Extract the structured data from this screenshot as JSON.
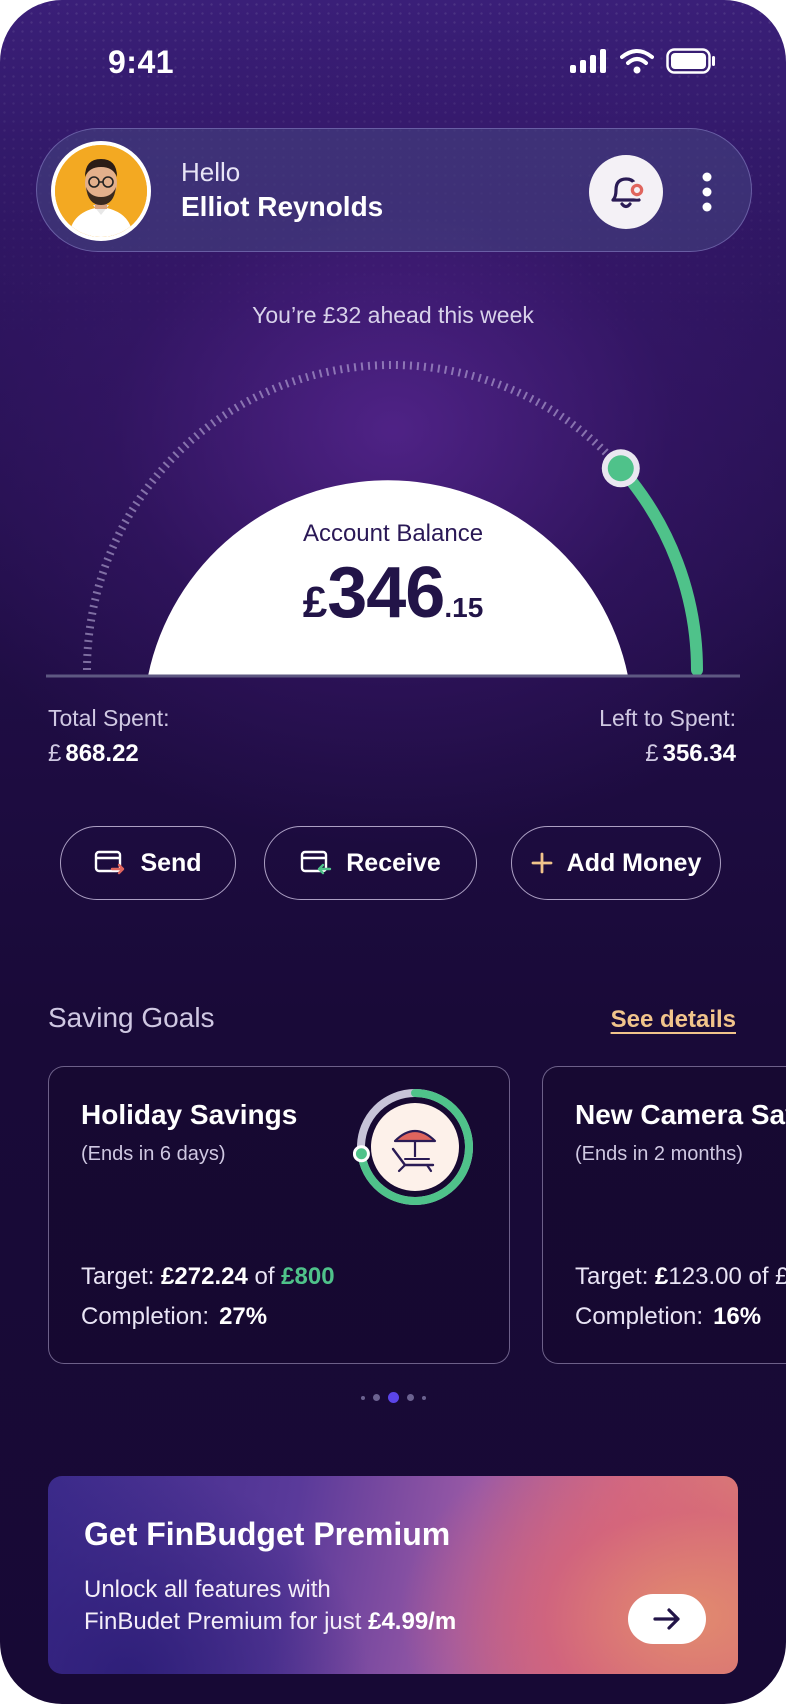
{
  "status": {
    "time": "9:41"
  },
  "header": {
    "greeting": "Hello",
    "name": "Elliot Reynolds"
  },
  "week_status": "You’re £32 ahead this week",
  "balance": {
    "label": "Account Balance",
    "currency": "£",
    "whole": "346",
    "cents": ".15",
    "gauge_progress": 0.77
  },
  "totals": {
    "spent_label": "Total Spent:",
    "spent_currency": "£",
    "spent_value": "868.22",
    "left_label": "Left to Spent:",
    "left_currency": "£",
    "left_value": "356.34"
  },
  "actions": {
    "send": "Send",
    "receive": "Receive",
    "add": "Add Money"
  },
  "saving_goals": {
    "title": "Saving Goals",
    "see_details": "See details",
    "goals": [
      {
        "title": "Holiday Savings",
        "ends": "(Ends in 6 days)",
        "target_label": "Target:",
        "current": "£272.24",
        "of": "of",
        "goal": "£800",
        "completion_label": "Completion:",
        "completion": "27%",
        "icon": "beach-chair-icon"
      },
      {
        "title": "New Camera Sav",
        "ends": "(Ends in 2 months)",
        "target_label": "Target:",
        "current": "£",
        "current_rest": "123.00",
        "of": "of £",
        "completion_label": "Completion:",
        "completion": "16%"
      }
    ],
    "pager": {
      "count": 5,
      "active": 2
    }
  },
  "premium": {
    "title": "Get FinBudget Premium",
    "line1": "Unlock all features with",
    "line2": "FinBudet Premium for just ",
    "price": "£4.99/m"
  },
  "colors": {
    "accent_green": "#4fc28a",
    "link": "#f1c48b",
    "brand_dark": "#221448",
    "alert": "#e0655e"
  }
}
